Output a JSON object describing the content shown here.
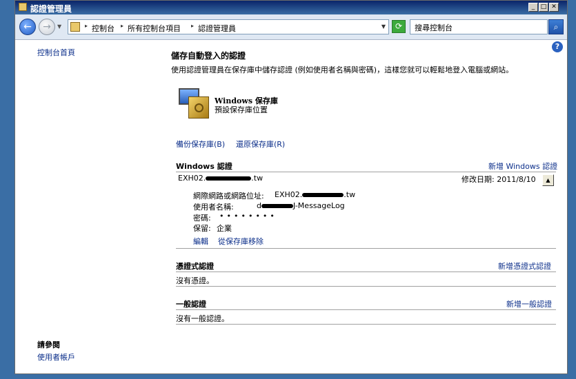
{
  "window": {
    "title": "認證管理員"
  },
  "toolbar": {
    "breadcrumbs": [
      "控制台",
      "所有控制台項目",
      "認證管理員"
    ],
    "search_placeholder": "搜尋控制台"
  },
  "sidebar": {
    "home_link": "控制台首頁",
    "see_also_title": "請參閱",
    "see_also_link": "使用者帳戶"
  },
  "main": {
    "heading": "儲存自動登入的認證",
    "description": "使用認證管理員在保存庫中儲存認證 (例如使用者名稱與密碼)，這樣您就可以輕鬆地登入電腦或網站。",
    "vault_title": "Windows 保存庫",
    "vault_subtitle": "預設保存庫位置",
    "backup_link": "備份保存庫(B)",
    "restore_link": "還原保存庫(R)"
  },
  "windows_creds": {
    "title": "Windows 認證",
    "add_link": "新增 Windows 認證",
    "entry": {
      "name_prefix": "EXH02.",
      "name_suffix": ".tw",
      "modified": "修改日期: 2011/8/10",
      "address_label": "網際網路或網路位址:",
      "address_prefix": "EXH02.",
      "address_suffix": ".tw",
      "username_label": "使用者名稱:",
      "username_prefix": "d",
      "username_suffix": "J-MessageLog",
      "password_label": "密碼:",
      "password_value": "••••••••",
      "persistence_label": "保留:",
      "persistence_value": "企業",
      "edit_link": "編輯",
      "remove_link": "從保存庫移除"
    }
  },
  "cert_creds": {
    "title": "憑證式認證",
    "add_link": "新增憑證式認證",
    "empty": "沒有憑證。"
  },
  "generic_creds": {
    "title": "一般認證",
    "add_link": "新增一般認證",
    "empty": "沒有一般認證。"
  }
}
